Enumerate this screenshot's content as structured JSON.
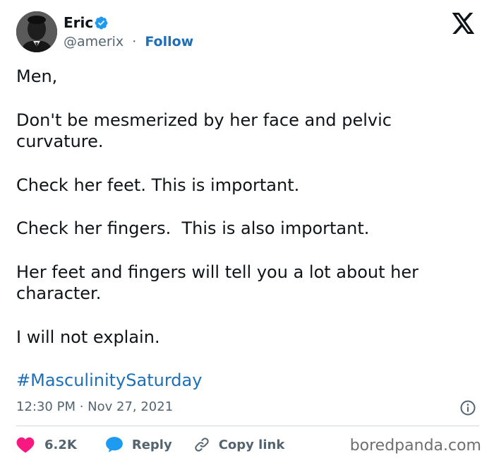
{
  "author": {
    "display_name": "Eric",
    "handle": "@amerix",
    "separator": "·",
    "follow_label": "Follow",
    "verified_color": "#1d9bf0"
  },
  "logo_icon": "x-logo-icon",
  "tweet": {
    "lines": [
      "Men,",
      "",
      "Don't be mesmerized by her face and pelvic",
      "curvature.",
      "",
      "Check her feet. This is important.",
      "",
      "Check her fingers.  This is also important.",
      "",
      "Her feet and fingers will tell you a lot about her",
      "character.",
      "",
      "I will not explain."
    ],
    "hashtag": "#MasculinitySaturday",
    "timestamp": "12:30 PM · Nov 27, 2021"
  },
  "actions": {
    "like_count": "6.2K",
    "reply_label": "Reply",
    "copy_link_label": "Copy link"
  },
  "watermark": "boredpanda.com",
  "colors": {
    "like": "#f91880",
    "reply": "#1d9bf0",
    "link": "#1d6fb8",
    "muted": "#536471"
  }
}
